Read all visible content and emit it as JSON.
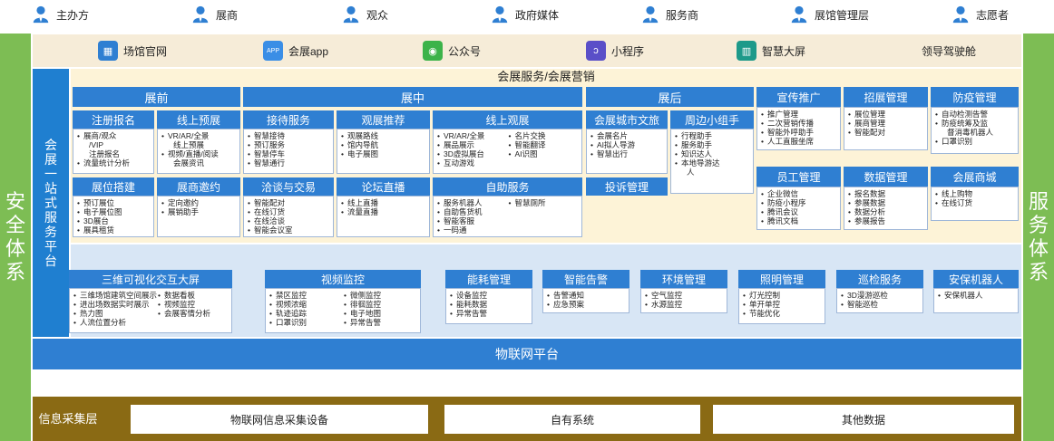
{
  "roles": [
    "主办方",
    "展商",
    "观众",
    "政府媒体",
    "服务商",
    "展馆管理层",
    "志愿者"
  ],
  "side_left": "安全体系",
  "side_right": "服务体系",
  "channels": [
    {
      "label": "场馆官网",
      "icon": "website-icon",
      "color": "#2f7fd2"
    },
    {
      "label": "会展app",
      "icon": "app-icon",
      "color": "#3a8ee6"
    },
    {
      "label": "公众号",
      "icon": "wechat-icon",
      "color": "#3cb34a"
    },
    {
      "label": "小程序",
      "icon": "mini-program-icon",
      "color": "#5a4fc8"
    },
    {
      "label": "智慧大屏",
      "icon": "big-screen-icon",
      "color": "#1e9a8a"
    },
    {
      "label": "领导驾驶舱",
      "icon": "",
      "color": ""
    }
  ],
  "platform_label": "会展一站式服务平台",
  "services_title": "会展服务/会展营销",
  "phases": {
    "pre": "展前",
    "mid": "展中",
    "post": "展后"
  },
  "modules": {
    "register": {
      "title": "注册报名",
      "items": [
        "展商/观众",
        "/VIP",
        "注册报名",
        "流量统计分析"
      ]
    },
    "preorder": {
      "title": "线上预展",
      "items": [
        "VR/AR/全景",
        "线上预展",
        "视频/直播/阅读",
        "会展资讯"
      ]
    },
    "reception": {
      "title": "接待服务",
      "items": [
        "智慧接待",
        "预订服务",
        "智慧停车",
        "智慧通行"
      ]
    },
    "recommend": {
      "title": "观展推荐",
      "items": [
        "观展路线",
        "馆内导航",
        "电子展图"
      ]
    },
    "online": {
      "title": "线上观展",
      "col1": [
        "VR/AR/全景",
        "展品展示",
        "3D虚拟展台",
        "互动游戏"
      ],
      "col2": [
        "名片交换",
        "智能翻译",
        "AI识图"
      ]
    },
    "citydoc": {
      "title": "会展城市文旅",
      "items": [
        "会展名片",
        "AI拟人导游",
        "智慧出行"
      ]
    },
    "assistant": {
      "title": "周边小组手",
      "items": [
        "行程助手",
        "服务助手",
        "知识达人",
        "本地导游达",
        "人"
      ]
    },
    "booth": {
      "title": "展位搭建",
      "items": [
        "预订展位",
        "电子展位图",
        "3D展台",
        "展具租赁"
      ]
    },
    "invite": {
      "title": "展商邀约",
      "items": [
        "定向邀约",
        "展销助手"
      ]
    },
    "negotiate": {
      "title": "洽谈与交易",
      "items": [
        "智能配对",
        "在线订货",
        "在线洽谈",
        "智能会议室"
      ]
    },
    "forum": {
      "title": "论坛直播",
      "items": [
        "线上直播",
        "流量直播"
      ]
    },
    "selfservice": {
      "title": "自助服务",
      "col1": [
        "服务机器人",
        "自助售货机",
        "智能客服",
        "一码通"
      ],
      "col2": [
        "智慧厕所"
      ]
    },
    "complaint": {
      "title": "投诉管理"
    },
    "promotion": {
      "title": "宣传推广",
      "items": [
        "推广管理",
        "二次营销传播",
        "智能外呼助手",
        "人工直服坐席"
      ]
    },
    "recruit": {
      "title": "招展管理",
      "items": [
        "展位管理",
        "展商管理",
        "智能配对"
      ]
    },
    "epidemic": {
      "title": "防疫管理",
      "items": [
        "自动检测告警",
        "防疫统筹及监",
        "督消毒机器人",
        "口罩识别"
      ]
    },
    "staff": {
      "title": "员工管理",
      "items": [
        "企业微信",
        "防疫小程序",
        "腾讯会议",
        "腾讯文档"
      ]
    },
    "data": {
      "title": "数据管理",
      "items": [
        "报名数据",
        "参展数据",
        "数据分析",
        "参展报告"
      ]
    },
    "mall": {
      "title": "会展商城",
      "items": [
        "线上购物",
        "在线订货"
      ]
    }
  },
  "infra": {
    "viz": {
      "title": "三维可视化交互大屏",
      "items": [
        "三维场馆建筑空间展示",
        "进出场数据实时展示",
        "热力图",
        "人流位置分析"
      ],
      "col2": [
        "数据看板",
        "视频监控",
        "会展客情分析"
      ]
    },
    "video": {
      "title": "视频监控",
      "col1": [
        "禁区监控",
        "视频浓缩",
        "轨迹追踪",
        "口罩识别"
      ],
      "col2": [
        "微侧监控",
        "徘徊监控",
        "电子地图",
        "异常告警"
      ]
    },
    "energy": {
      "title": "能耗管理",
      "items": [
        "设备监控",
        "能耗数据",
        "异常告警"
      ]
    },
    "alarm": {
      "title": "智能告警",
      "items": [
        "告警通知",
        "应急预案"
      ]
    },
    "env": {
      "title": "环境管理",
      "items": [
        "空气监控",
        "水源监控"
      ]
    },
    "light": {
      "title": "照明管理",
      "items": [
        "灯光控制",
        "单开单控",
        "节能优化"
      ]
    },
    "patrol": {
      "title": "巡检服务",
      "items": [
        "3D漫游巡检",
        "智能巡检"
      ]
    },
    "robot": {
      "title": "安保机器人",
      "items": [
        "安保机器人"
      ]
    }
  },
  "iot_platform": "物联网平台",
  "collect_label": "信息采集层",
  "collect_items": [
    "物联网信息采集设备",
    "自有系统",
    "其他数据"
  ]
}
